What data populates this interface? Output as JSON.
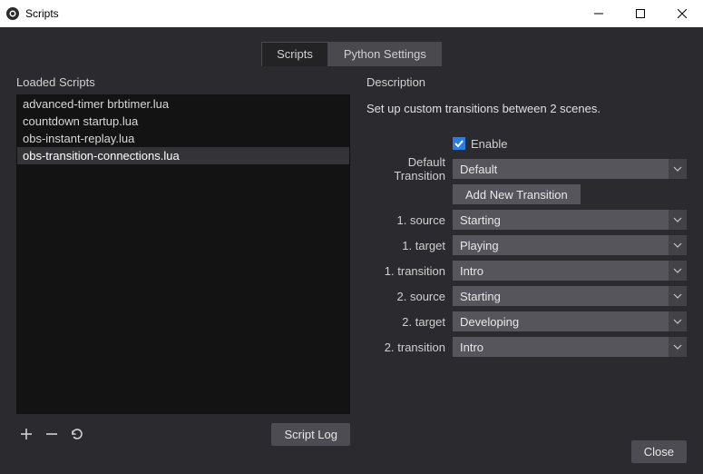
{
  "window": {
    "title": "Scripts"
  },
  "tabs": {
    "scripts": "Scripts",
    "python": "Python Settings"
  },
  "left": {
    "label": "Loaded Scripts",
    "scripts": [
      "advanced-timer brbtimer.lua",
      "countdown startup.lua",
      "obs-instant-replay.lua",
      "obs-transition-connections.lua"
    ],
    "script_log": "Script Log"
  },
  "right": {
    "label": "Description",
    "description": "Set up custom transitions between 2 scenes.",
    "enable_label": "Enable",
    "enable_checked": true,
    "fields": {
      "default_transition": {
        "label": "Default Transition",
        "value": "Default"
      },
      "add_new": "Add New Transition",
      "source1": {
        "label": "1. source",
        "value": "Starting"
      },
      "target1": {
        "label": "1. target",
        "value": "Playing"
      },
      "transition1": {
        "label": "1. transition",
        "value": "Intro"
      },
      "source2": {
        "label": "2. source",
        "value": "Starting"
      },
      "target2": {
        "label": "2. target",
        "value": "Developing"
      },
      "transition2": {
        "label": "2. transition",
        "value": "Intro"
      }
    }
  },
  "footer": {
    "close": "Close"
  }
}
